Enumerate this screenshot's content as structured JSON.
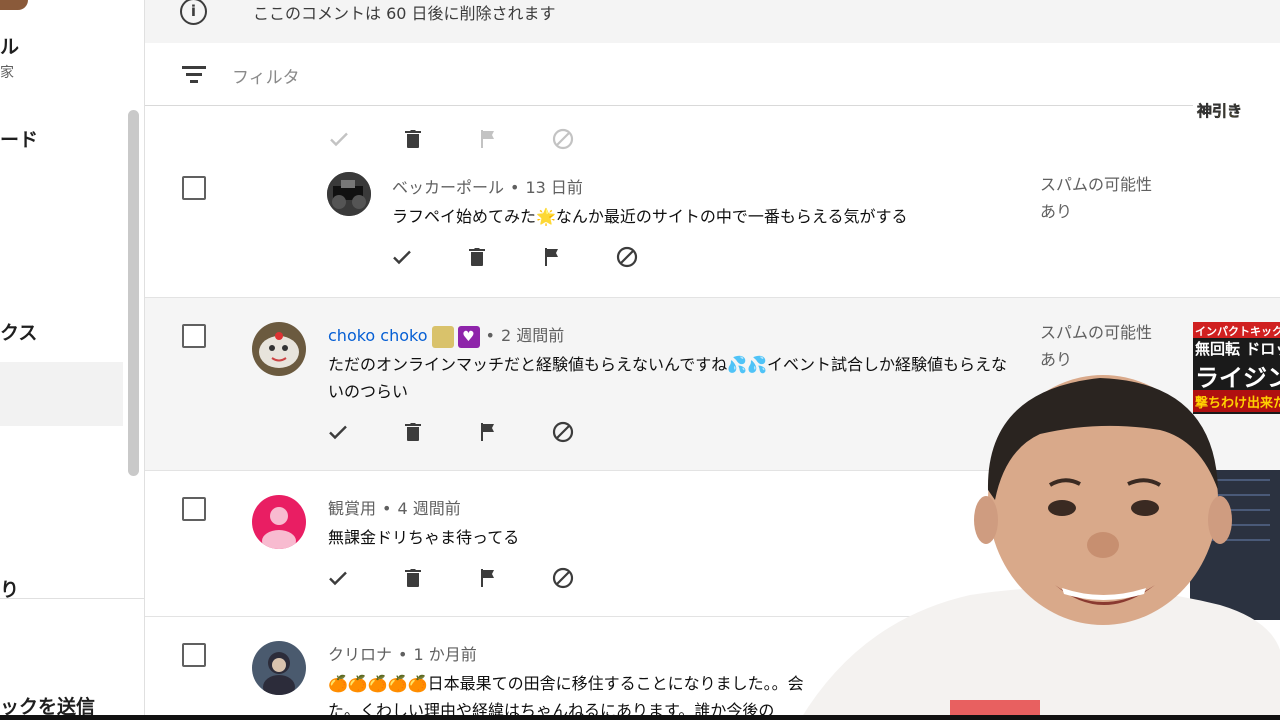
{
  "sidebar": {
    "channel_name_partial": "ル",
    "channel_sub_partial": "ル家",
    "items": [
      {
        "label": "ード"
      },
      {
        "label": "クス"
      },
      {
        "label": "り"
      },
      {
        "label": "ックを送信"
      }
    ]
  },
  "notice": {
    "icon": "info-icon",
    "text": "ここのコメントは 60 日後に削除されます"
  },
  "filter": {
    "icon": "filter-icon",
    "label": "フィルタ"
  },
  "comments": [
    {
      "author": "ベッカーポール",
      "time": "13 日前",
      "text": "ラフペイ始めてみた🌟なんか最近のサイトの中で一番もらえる気がする",
      "status": "スパムの可能性あり"
    },
    {
      "author": "choko choko",
      "time": "2 週間前",
      "text": "ただのオンラインマッチだと経験値もらえないんですね💦💦イベント試合しか経験値もらえないのつらい",
      "status": "スパムの可能性あり"
    },
    {
      "author": "観賞用",
      "time": "4 週間前",
      "text": "無課金ドリちゃま待ってる"
    },
    {
      "author": "クリロナ",
      "time": "1 か月前",
      "text_line1": "🍊🍊🍊🍊🍊日本最果ての田舎に移住することになりました。。会",
      "text_line2": "た。くわしい理由や経緯はちゃんねるにあります。誰か今後の"
    }
  ],
  "thumbnails": [
    {
      "text": "神引き"
    },
    {
      "line1": "インパクトキック",
      "line2": "無回転 ドロッ",
      "line3": "ライジング",
      "line4": "撃ちわけ出来た"
    }
  ],
  "colors": {
    "link_blue": "#065fd4",
    "muted": "#606060",
    "highlight_row": "#f5f5f5",
    "member_badge": "#8e24aa"
  }
}
